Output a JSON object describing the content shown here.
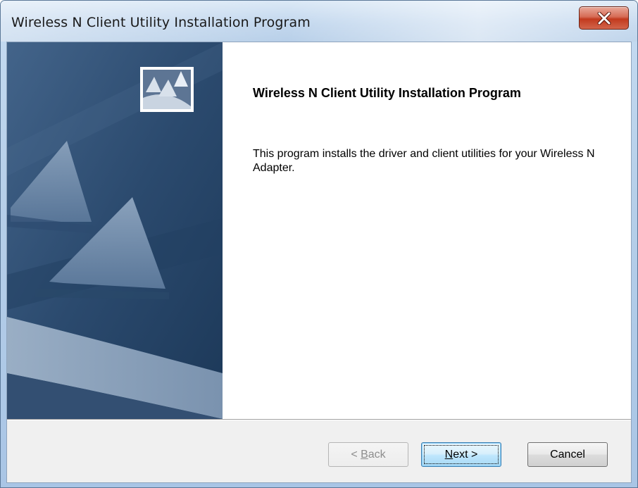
{
  "window": {
    "title": "Wireless N Client Utility Installation Program"
  },
  "content": {
    "heading": "Wireless N Client Utility Installation Program",
    "description": "This program installs the driver and client utilities for your Wireless N Adapter."
  },
  "buttons": {
    "back": {
      "prefix": "< ",
      "mnemonic": "B",
      "rest": "ack",
      "enabled": false
    },
    "next": {
      "mnemonic": "N",
      "rest": "ext >",
      "default": true
    },
    "cancel": {
      "label": "Cancel"
    }
  },
  "icons": {
    "close": "close-icon",
    "logo": "installer-logo-icon",
    "banner": "sail-banner-graphic"
  },
  "colors": {
    "banner_blue": "#2c4a6d",
    "close_red": "#c23a1e",
    "default_button_blue": "#bee6fd"
  }
}
